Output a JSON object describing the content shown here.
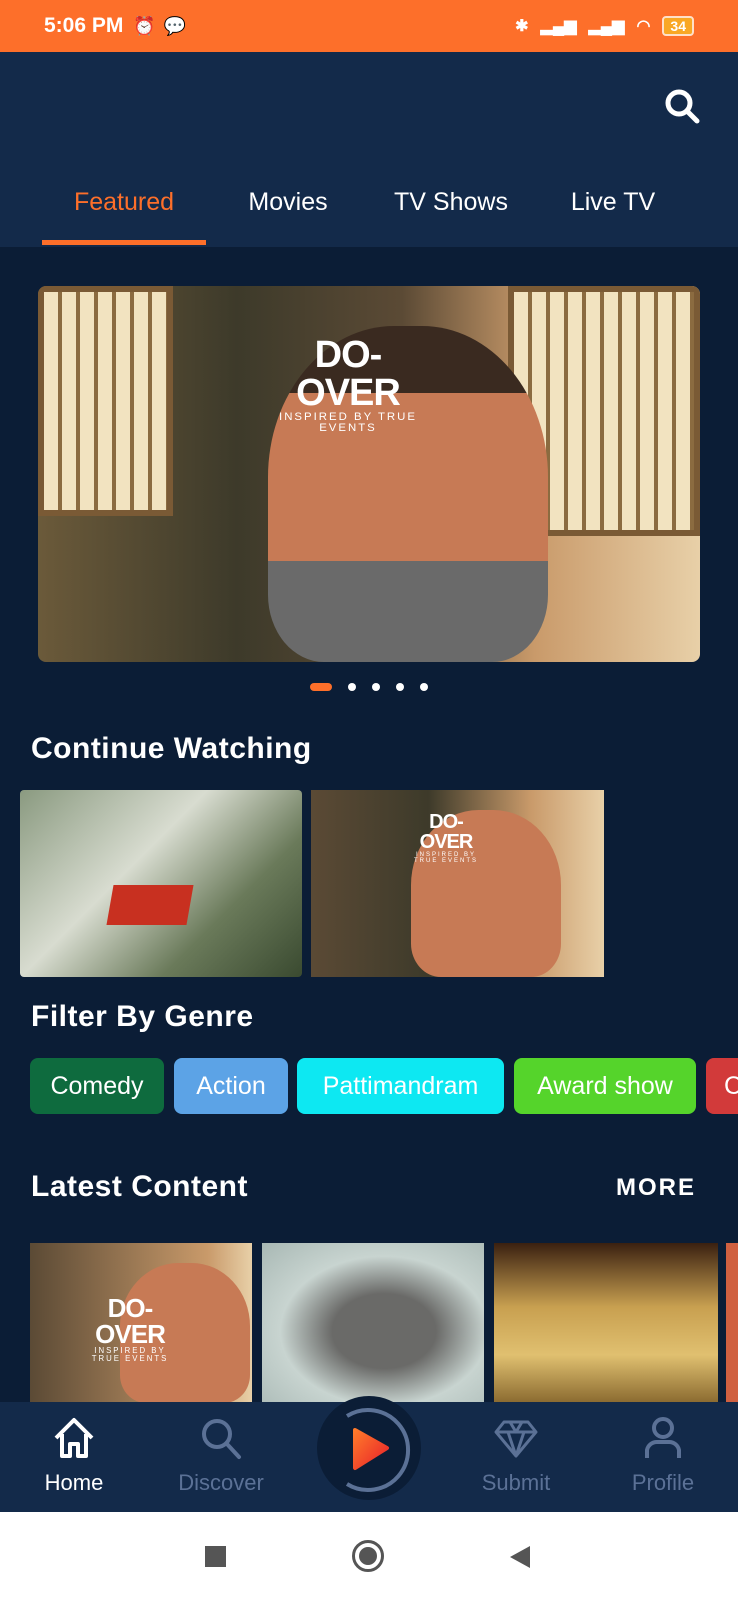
{
  "status_bar": {
    "time": "5:06 PM",
    "battery": "34"
  },
  "tabs": [
    {
      "label": "Featured",
      "active": true
    },
    {
      "label": "Movies"
    },
    {
      "label": "TV Shows"
    },
    {
      "label": "Live TV"
    }
  ],
  "banner": {
    "poster_title": "DO-OVER",
    "poster_tagline": "INSPIRED BY TRUE EVENTS",
    "slides": 5,
    "active_slide": 1
  },
  "continue_watching": {
    "title": "Continue Watching",
    "items": [
      {
        "poster": "tamil-title-poster"
      },
      {
        "poster_title": "DO-OVER",
        "poster_tagline": "INSPIRED BY TRUE EVENTS"
      }
    ]
  },
  "genres": {
    "title": "Filter By Genre",
    "items": [
      {
        "label": "Comedy",
        "color": "#0e6b3e"
      },
      {
        "label": "Action",
        "color": "#5ca3e6"
      },
      {
        "label": "Pattimandram",
        "color": "#0de8f2"
      },
      {
        "label": "Award show",
        "color": "#55d42b"
      },
      {
        "label": "C",
        "color": "#d23a3a"
      }
    ]
  },
  "latest": {
    "title": "Latest Content",
    "more": "MORE",
    "items": [
      {
        "poster_title": "DO-OVER",
        "poster_tagline": "INSPIRED BY TRUE EVENTS"
      },
      {
        "poster": "woman-closeup"
      },
      {
        "poster": "royal-costume"
      }
    ]
  },
  "bottom_nav": [
    {
      "label": "Home",
      "icon": "home-icon",
      "active": true
    },
    {
      "label": "Discover",
      "icon": "search-icon"
    },
    {
      "label": "",
      "icon": "play-icon"
    },
    {
      "label": "Submit",
      "icon": "diamond-icon"
    },
    {
      "label": "Profile",
      "icon": "user-icon"
    }
  ],
  "colors": {
    "accent": "#fd6f2a",
    "header": "#132a4a",
    "background": "#0b1d36"
  }
}
